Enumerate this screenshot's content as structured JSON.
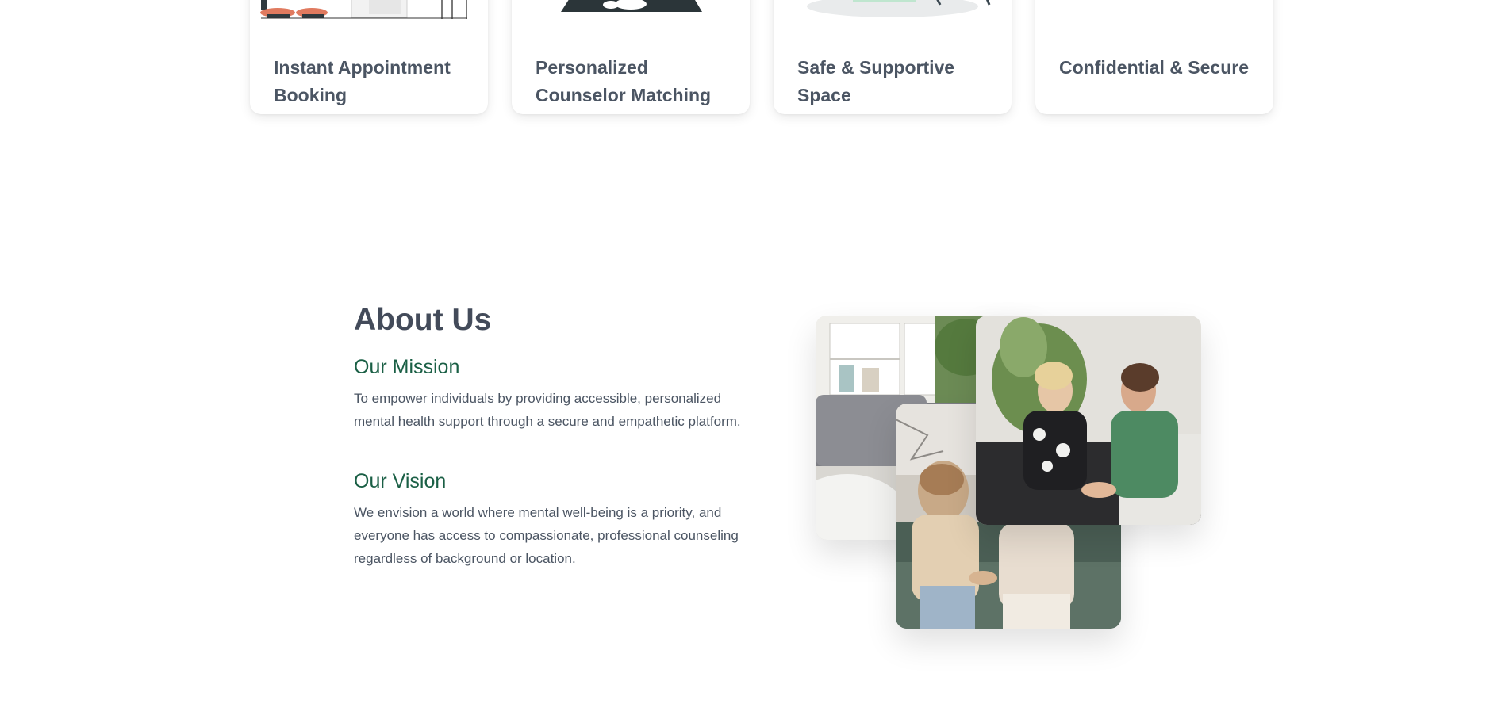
{
  "features": {
    "cards": [
      {
        "title": "Instant Appointment Booking",
        "illustration": "booking-illustration"
      },
      {
        "title": "Personalized Counselor Matching",
        "illustration": "matching-illustration"
      },
      {
        "title": "Safe & Supportive Space",
        "illustration": "supportive-space-illustration"
      },
      {
        "title": "Confidential & Secure",
        "illustration": ""
      }
    ]
  },
  "about": {
    "heading": "About Us",
    "mission": {
      "title": "Our Mission",
      "text": "To empower individuals by providing accessible, personalized mental health support through a secure and empathetic platform."
    },
    "vision": {
      "title": "Our Vision",
      "text": "We envision a world where mental well-being is a priority, and everyone has access to compassionate, professional counseling regardless of background or location."
    }
  },
  "colors": {
    "heading": "#434b5a",
    "accent_green": "#1a5f45",
    "body_text": "#4b5563"
  }
}
